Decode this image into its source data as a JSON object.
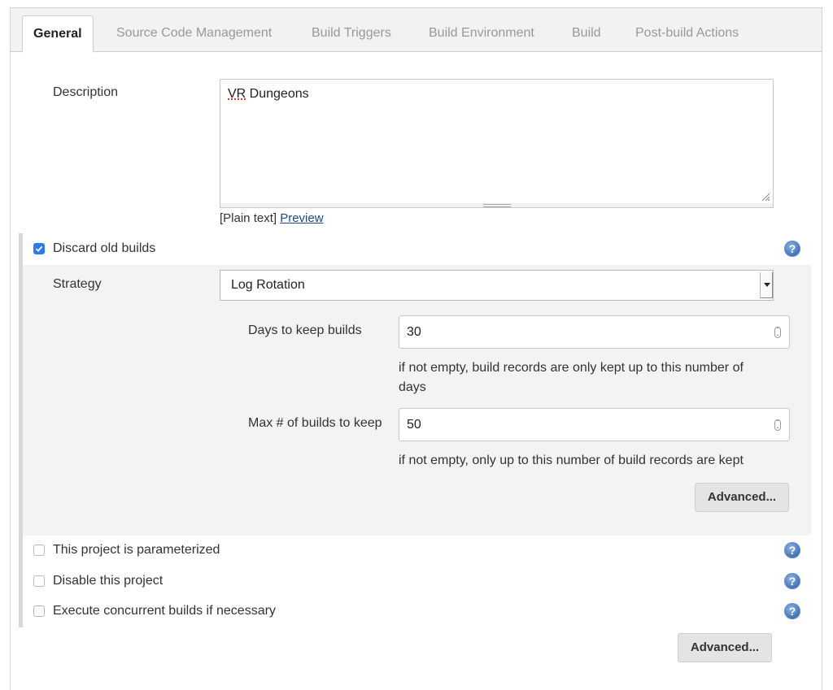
{
  "tabs": [
    {
      "label": "General"
    },
    {
      "label": "Source Code Management"
    },
    {
      "label": "Build Triggers"
    },
    {
      "label": "Build Environment"
    },
    {
      "label": "Build"
    },
    {
      "label": "Post-build Actions"
    }
  ],
  "description": {
    "label": "Description",
    "value_misspelled": "VR",
    "value_rest": " Dungeons",
    "format": "[Plain text]",
    "preview_link": "Preview"
  },
  "discard_old_builds": {
    "label": "Discard old builds",
    "checked": true,
    "strategy_label": "Strategy",
    "strategy_value": "Log Rotation",
    "days_label": "Days to keep builds",
    "days_value": "30",
    "days_hint": "if not empty, build records are only kept up to this number of days",
    "max_label": "Max # of builds to keep",
    "max_value": "50",
    "max_hint": "if not empty, only up to this number of build records are kept",
    "advanced_label": "Advanced..."
  },
  "options": [
    {
      "label": "This project is parameterized",
      "checked": false
    },
    {
      "label": "Disable this project",
      "checked": false
    },
    {
      "label": "Execute concurrent builds if necessary",
      "checked": false
    }
  ],
  "footer": {
    "advanced_label": "Advanced..."
  },
  "icons": {
    "help": "help-icon",
    "check": "checkmark-icon"
  },
  "colors": {
    "accent": "#2f7ae5",
    "link": "#204a87",
    "help": "#3d6fb5"
  }
}
